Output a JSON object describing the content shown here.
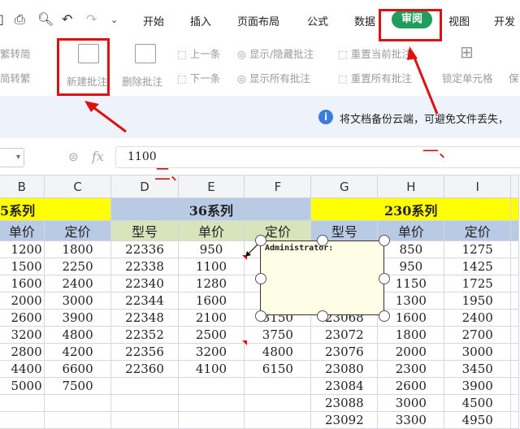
{
  "quick_access": [
    "print-icon",
    "print-preview-icon",
    "undo-icon",
    "redo-icon",
    "more-icon"
  ],
  "tabs": [
    "开始",
    "插入",
    "页面布局",
    "公式",
    "数据",
    "审阅",
    "视图",
    "开发"
  ],
  "ribbon": {
    "trad_to_simp": "繁转简",
    "simp_to_trad": "简转繁",
    "new_comment": "新建批注",
    "delete_comment": "删除批注",
    "prev": "上一条",
    "next": "下一条",
    "show_hide": "显示/隐藏批注",
    "show_all": "显示所有批注",
    "reset_current": "重置当前批注",
    "reset_all": "重置所有批注",
    "lock_cell": "锁定单元格",
    "protect": "保"
  },
  "banner": {
    "text": "将文档备份云端，可避免文件丢失，"
  },
  "formula_bar": {
    "fx": "fx",
    "value": "1100"
  },
  "annotations": {
    "mark1": "一、",
    "mark2": "二、"
  },
  "sheet": {
    "columns": [
      "B",
      "C",
      "D",
      "E",
      "F",
      "G",
      "H",
      "I"
    ],
    "series": [
      "5系列",
      "36系列",
      "230系列"
    ],
    "subheaders": [
      "单价",
      "定价",
      "型号",
      "单价",
      "定价",
      "型号",
      "单价",
      "定价"
    ],
    "rows": [
      [
        "1200",
        "1800",
        "22336",
        "950",
        "",
        "",
        "850",
        "1275"
      ],
      [
        "1500",
        "2250",
        "22338",
        "1100",
        "",
        "",
        "950",
        "1425"
      ],
      [
        "1600",
        "2400",
        "22340",
        "1280",
        "",
        "",
        "1150",
        "1725"
      ],
      [
        "2000",
        "3000",
        "22344",
        "1600",
        "",
        "",
        "1300",
        "1950"
      ],
      [
        "2600",
        "3900",
        "22348",
        "2100",
        "3150",
        "23068",
        "1600",
        "2400"
      ],
      [
        "3200",
        "4800",
        "22352",
        "2500",
        "3750",
        "23072",
        "1800",
        "2700"
      ],
      [
        "2800",
        "4200",
        "22356",
        "3200",
        "4800",
        "23076",
        "2000",
        "3000"
      ],
      [
        "4400",
        "6600",
        "22360",
        "4100",
        "6150",
        "23080",
        "2300",
        "3450"
      ],
      [
        "5000",
        "7500",
        "",
        "",
        "",
        "23084",
        "2600",
        "3900"
      ],
      [
        "",
        "",
        "",
        "",
        "",
        "23088",
        "3000",
        "4500"
      ],
      [
        "",
        "",
        "",
        "",
        "",
        "23092",
        "3300",
        "4950"
      ]
    ],
    "comment_author": "Administrator:"
  }
}
